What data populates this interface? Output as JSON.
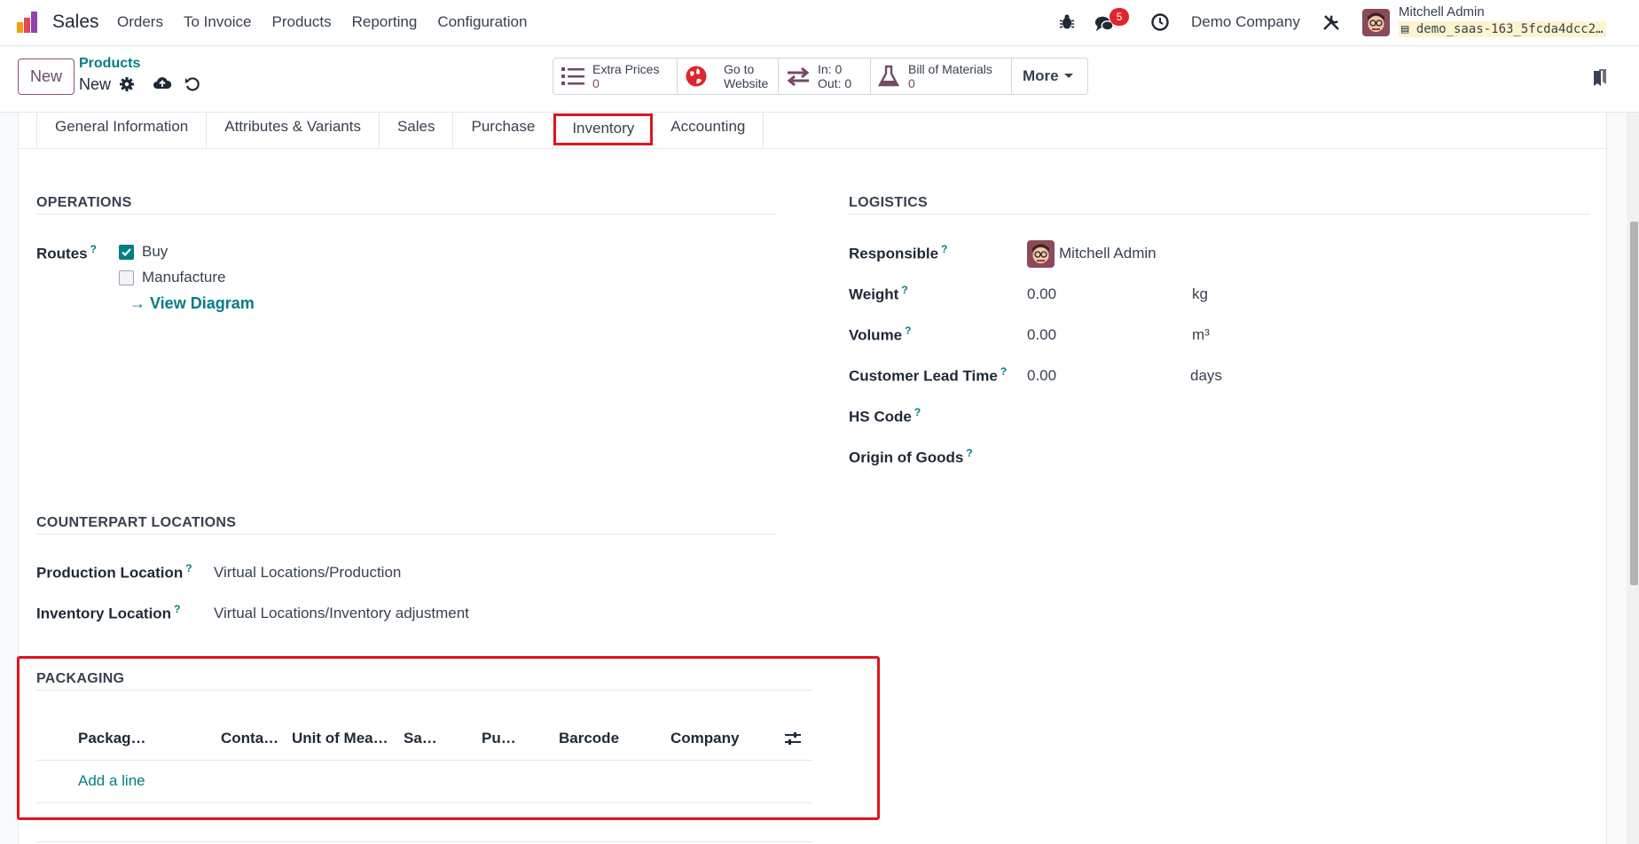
{
  "navbar": {
    "app_name": "Sales",
    "menu": [
      "Orders",
      "To Invoice",
      "Products",
      "Reporting",
      "Configuration"
    ],
    "messages_count": "5",
    "company": "Demo Company",
    "user_name": "Mitchell Admin",
    "db_name": "demo_saas-163_5fcda4dcc2…"
  },
  "control": {
    "new_label": "New",
    "breadcrumb_parent": "Products",
    "breadcrumb_current": "New",
    "stats": [
      {
        "label": "Extra Prices",
        "value": "0"
      },
      {
        "label": "Go to",
        "value": "Website"
      },
      {
        "label": "In: 0",
        "value": "Out: 0"
      },
      {
        "label": "Bill of Materials",
        "value": "0"
      }
    ],
    "more_label": "More"
  },
  "tabs": [
    "General Information",
    "Attributes & Variants",
    "Sales",
    "Purchase",
    "Inventory",
    "Accounting"
  ],
  "active_tab": "Inventory",
  "operations": {
    "title": "OPERATIONS",
    "routes_label": "Routes",
    "routes": [
      {
        "label": "Buy",
        "checked": true
      },
      {
        "label": "Manufacture",
        "checked": false
      }
    ],
    "view_diagram": "→ View Diagram"
  },
  "logistics": {
    "title": "LOGISTICS",
    "responsible_label": "Responsible",
    "responsible_value": "Mitchell Admin",
    "weight_label": "Weight",
    "weight_value": "0.00",
    "weight_unit": "kg",
    "volume_label": "Volume",
    "volume_value": "0.00",
    "volume_unit": "m³",
    "lead_time_label": "Customer Lead Time",
    "lead_time_value": "0.00",
    "lead_time_unit": "days",
    "hs_code_label": "HS Code",
    "origin_label": "Origin of Goods"
  },
  "counterpart": {
    "title": "COUNTERPART LOCATIONS",
    "production_label": "Production Location",
    "production_value": "Virtual Locations/Production",
    "inventory_label": "Inventory Location",
    "inventory_value": "Virtual Locations/Inventory adjustment"
  },
  "packaging": {
    "title": "PACKAGING",
    "columns": [
      "Packag…",
      "Conta…",
      "Unit of Mea…",
      "Sa…",
      "Pu…",
      "Barcode",
      "Company"
    ],
    "add_line": "Add a line"
  },
  "colors": {
    "brand": "#714b67",
    "teal": "#017e84",
    "highlight": "#e0141e"
  }
}
